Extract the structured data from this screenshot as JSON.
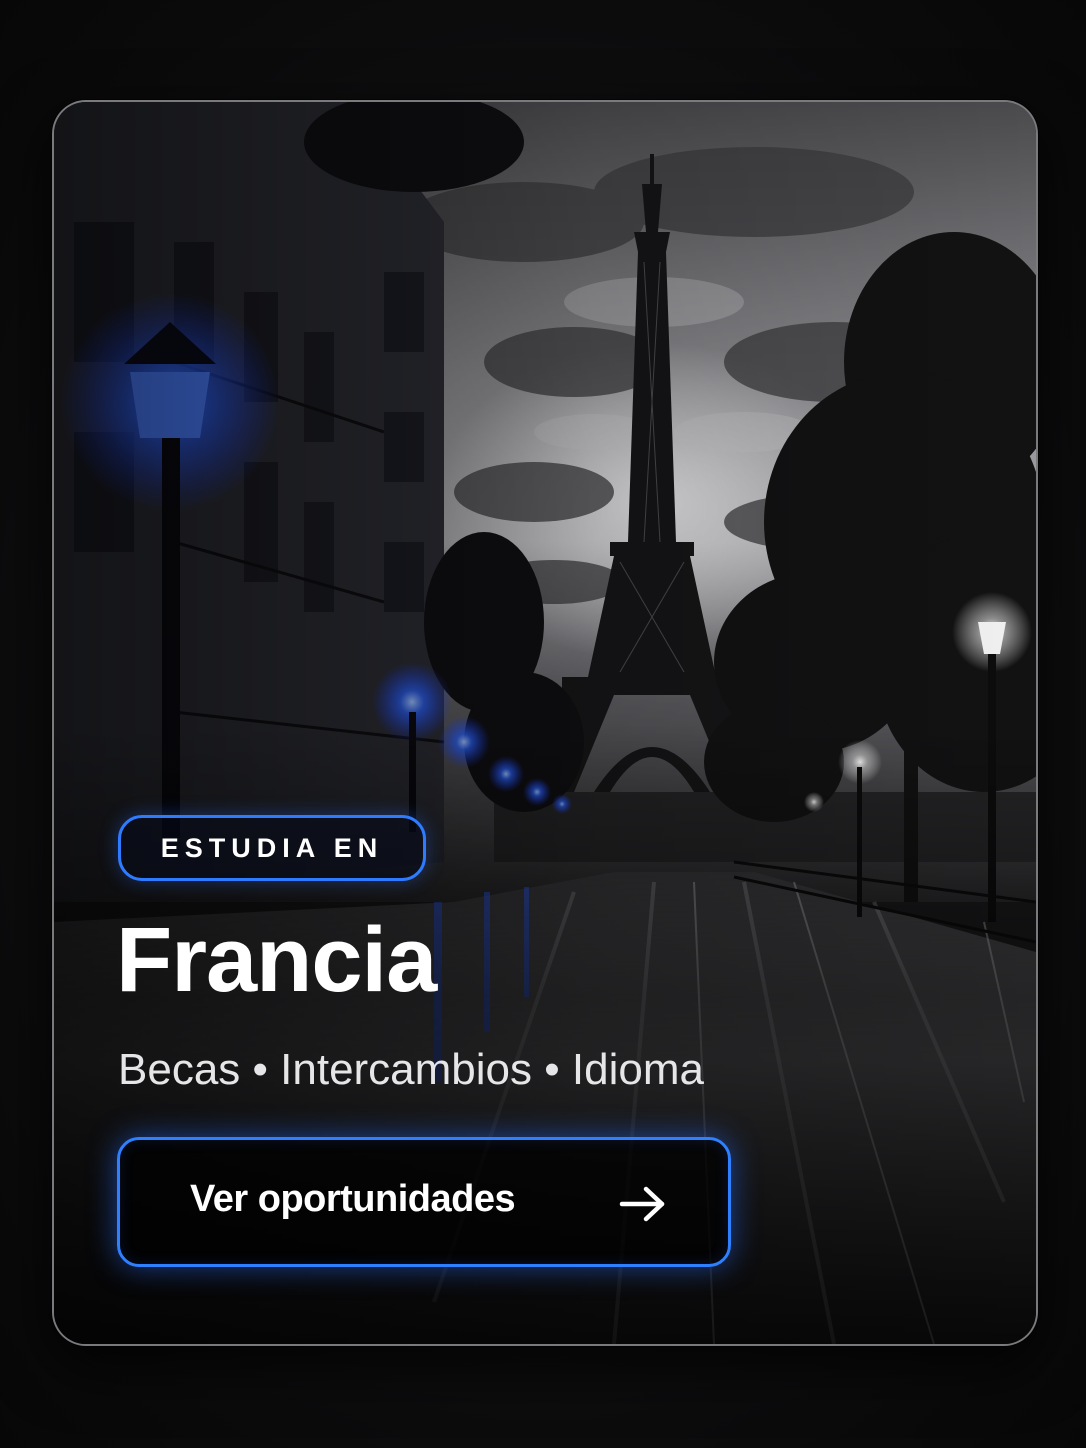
{
  "card": {
    "scene_icon": "paris-eiffel-tower-night-street-photo",
    "badge_label": "ESTUDIA EN",
    "title": "Francia",
    "subtitle": "Becas • Intercambios • Idioma",
    "cta_label": "Ver oportunidades",
    "cta_icon": "arrow-right-icon"
  },
  "colors": {
    "accent_blue": "#2f7bff",
    "background": "#0c0c0d",
    "text": "#ffffff"
  }
}
